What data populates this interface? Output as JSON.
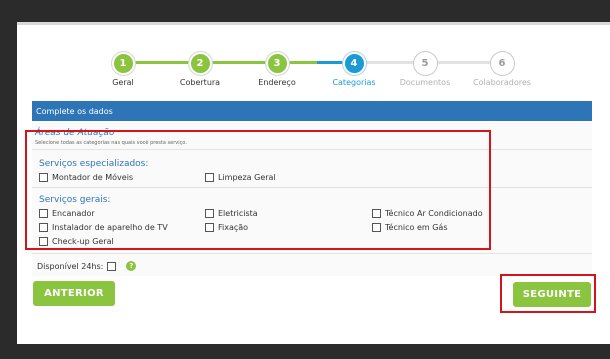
{
  "stepper": {
    "steps": [
      {
        "num": "1",
        "label": "Geral",
        "state": "done"
      },
      {
        "num": "2",
        "label": "Cobertura",
        "state": "done"
      },
      {
        "num": "3",
        "label": "Endereço",
        "state": "done"
      },
      {
        "num": "4",
        "label": "Categorias",
        "state": "current"
      },
      {
        "num": "5",
        "label": "Documentos",
        "state": "todo"
      },
      {
        "num": "6",
        "label": "Colaboradores",
        "state": "todo"
      }
    ]
  },
  "section": {
    "title": "Complete os dados"
  },
  "areas": {
    "title": "Áreas de Atuação",
    "subtitle": "Selecione todas as categorias nas quais você presta serviço."
  },
  "especializados": {
    "title": "Serviços especializados:",
    "items": [
      "Montador de Móveis",
      "Limpeza Geral"
    ]
  },
  "gerais": {
    "title": "Serviços gerais:",
    "items": [
      "Encanador",
      "Eletricista",
      "Técnico Ar Condicionado",
      "Instalador de aparelho de TV",
      "Fixação",
      "Técnico em Gás",
      "Check-up Geral"
    ]
  },
  "disponivel": {
    "label": "Disponível 24hs:",
    "help_icon": "?"
  },
  "buttons": {
    "back": "ANTERIOR",
    "next": "SEGUINTE"
  },
  "colors": {
    "accent_green": "#8bc43f",
    "accent_blue": "#2d75b6",
    "highlight_red": "#d4141c"
  }
}
